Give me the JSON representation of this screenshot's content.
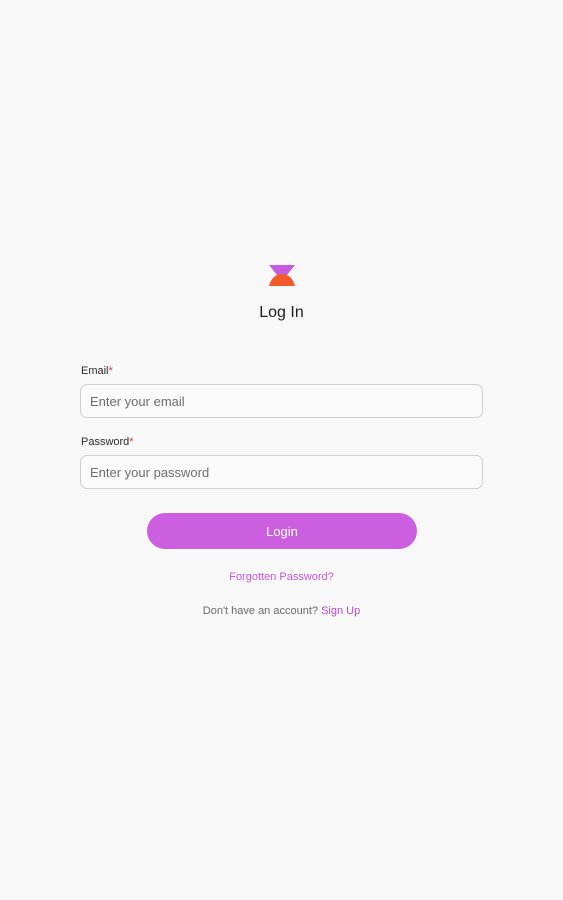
{
  "brand": {
    "logo_icon": "hourglass-logo-icon",
    "logo_top_color": "#c45ce0",
    "logo_bottom_color": "#f15a29"
  },
  "header": {
    "title": "Log In"
  },
  "form": {
    "email": {
      "label": "Email",
      "required_mark": "*",
      "placeholder": "Enter your email",
      "value": ""
    },
    "password": {
      "label": "Password",
      "required_mark": "*",
      "placeholder": "Enter your password",
      "value": ""
    },
    "submit_label": "Login",
    "forgot_label": "Forgotten Password?"
  },
  "footer": {
    "signup_prompt": "Don't have an account?",
    "signup_link": "Sign Up"
  },
  "colors": {
    "accent": "#cb5fdf",
    "link": "#c257d8",
    "required": "#e0312b",
    "background": "#f8f8f9"
  }
}
